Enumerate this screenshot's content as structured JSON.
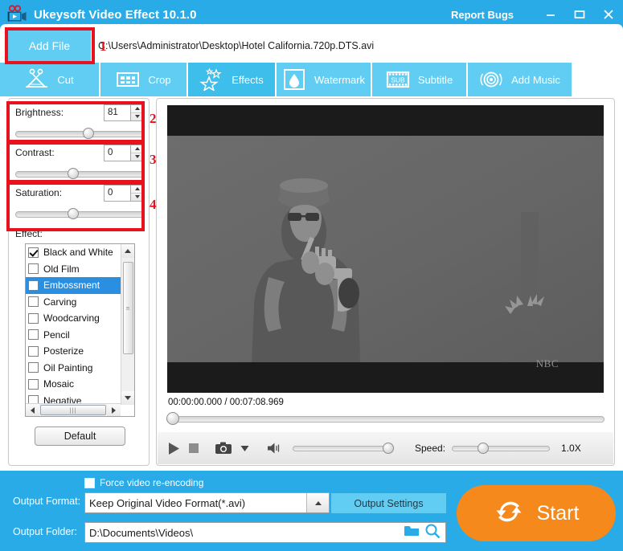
{
  "window": {
    "title": "Ukeysoft Video Effect 10.1.0",
    "app_icon": "movie-camera-icon",
    "report_bugs": "Report Bugs",
    "minimize": "minimize-icon",
    "maximize": "maximize-icon",
    "close": "close-icon"
  },
  "toolbar": {
    "add_file_label": "Add File",
    "file_path": "C:\\Users\\Administrator\\Desktop\\Hotel California.720p.DTS.avi"
  },
  "tabs": [
    {
      "label": "Cut",
      "icon": "scissors-icon",
      "active": false
    },
    {
      "label": "Crop",
      "icon": "crop-frame-icon",
      "active": false
    },
    {
      "label": "Effects",
      "icon": "stars-icon",
      "active": true
    },
    {
      "label": "Watermark",
      "icon": "droplet-icon",
      "active": false
    },
    {
      "label": "Subtitle",
      "icon": "sub-film-icon",
      "active": false
    },
    {
      "label": "Add Music",
      "icon": "speaker-ring-icon",
      "active": false
    }
  ],
  "adjustments": [
    {
      "label": "Brightness:",
      "value": "81",
      "percent": 57
    },
    {
      "label": "Contrast:",
      "value": "0",
      "percent": 44
    },
    {
      "label": "Saturation:",
      "value": "0",
      "percent": 44
    }
  ],
  "effects": {
    "label": "Effect:",
    "items": [
      {
        "label": "Black and White",
        "checked": true,
        "selected": false
      },
      {
        "label": "Old Film",
        "checked": false,
        "selected": false
      },
      {
        "label": "Embossment",
        "checked": false,
        "selected": true
      },
      {
        "label": "Carving",
        "checked": false,
        "selected": false
      },
      {
        "label": "Woodcarving",
        "checked": false,
        "selected": false
      },
      {
        "label": "Pencil",
        "checked": false,
        "selected": false
      },
      {
        "label": "Posterize",
        "checked": false,
        "selected": false
      },
      {
        "label": "Oil Painting",
        "checked": false,
        "selected": false
      },
      {
        "label": "Mosaic",
        "checked": false,
        "selected": false
      },
      {
        "label": "Negative",
        "checked": false,
        "selected": false
      }
    ],
    "default_button": "Default"
  },
  "preview": {
    "watermark_text": "NBC",
    "time_display": "00:00:00.000 / 00:07:08.969",
    "play_icon": "play-icon",
    "stop_icon": "stop-icon",
    "snapshot_icon": "camera-icon",
    "snapshot_dropdown_icon": "chevron-down-icon",
    "volume_icon": "speaker-icon",
    "speed_label": "Speed:",
    "speed_value": "1.0X"
  },
  "output": {
    "force_reencode_label": "Force video re-encoding",
    "force_reencode_checked": false,
    "format_label": "Output Format:",
    "format_value": "Keep Original Video Format(*.avi)",
    "format_arrow_icon": "triangle-up-icon",
    "settings_button": "Output Settings",
    "folder_label": "Output Folder:",
    "folder_value": "D:\\Documents\\Videos\\",
    "browse_icon": "folder-icon",
    "search_icon": "magnifier-icon",
    "start_label": "Start",
    "start_icon": "refresh-loop-icon"
  },
  "annotations": [
    {
      "number": "1"
    },
    {
      "number": "2"
    },
    {
      "number": "3"
    },
    {
      "number": "4"
    }
  ],
  "colors": {
    "brand_blue": "#29ABE8",
    "tab_blue": "#62CDF2",
    "tab_active_blue": "#3EBEEA",
    "accent_orange": "#F5891B",
    "annotation_red": "#E8121E",
    "selection_blue": "#2A8FE0"
  }
}
